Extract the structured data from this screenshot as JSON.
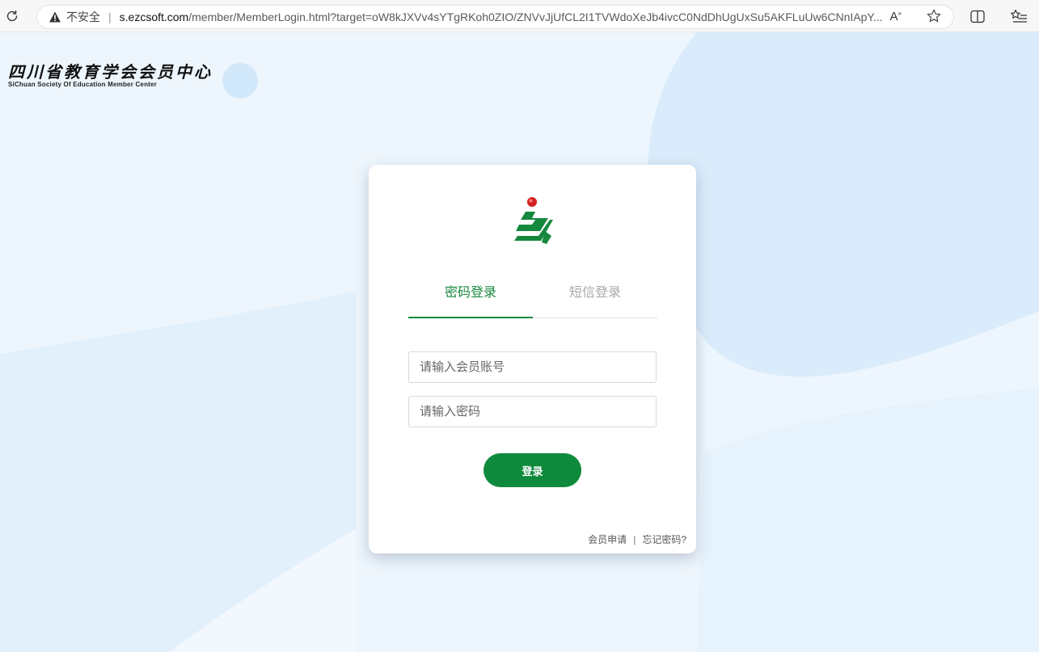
{
  "browser": {
    "security_label": "不安全",
    "url_separator": "|",
    "url_host": "s.ezcsoft.com",
    "url_path": "/member/MemberLogin.html?target=oW8kJXVv4sYTgRKoh0ZIO/ZNVvJjUfCL2I1TVWdoXeJb4ivcC0NdDhUgUxSu5AKFLuUw6CNnIApY...",
    "read_aloud_label": "A",
    "read_aloud_sup": "»",
    "icons": [
      "reload-icon",
      "warning-icon",
      "read-aloud-icon",
      "favorite-star-icon",
      "split-screen-icon",
      "favorites-list-icon"
    ]
  },
  "brand": {
    "name_cn": "四川省教育学会会员中心",
    "name_en": "SiChuan Society Of Education Member Center"
  },
  "login": {
    "tabs": [
      {
        "label": "密码登录",
        "active": true
      },
      {
        "label": "短信登录",
        "active": false
      }
    ],
    "account_placeholder": "请输入会员账号",
    "password_placeholder": "请输入密码",
    "submit_label": "登录",
    "apply_link": "会员申请",
    "link_separator": "|",
    "forgot_link": "忘记密码?"
  },
  "colors": {
    "accent_green": "#0f8a3c",
    "logo_red": "#d42020",
    "background": "#eef6fd"
  }
}
